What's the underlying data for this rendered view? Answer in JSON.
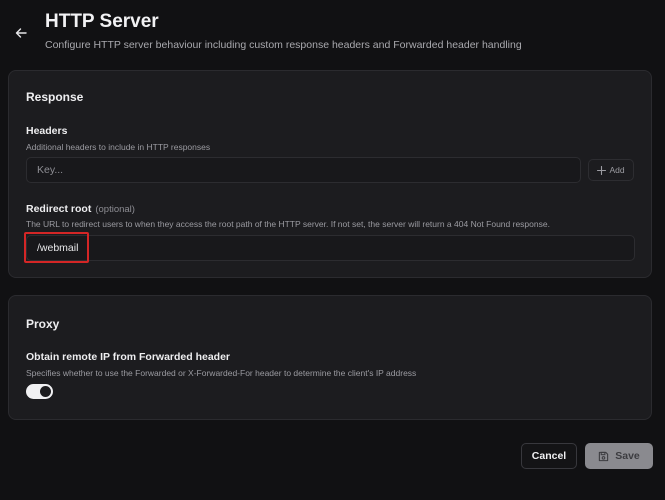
{
  "header": {
    "title": "HTTP Server",
    "subtitle": "Configure HTTP server behaviour including custom response headers and Forwarded header handling"
  },
  "response": {
    "title": "Response",
    "headers": {
      "label": "Headers",
      "description": "Additional headers to include in HTTP responses",
      "key_placeholder": "Key...",
      "add_label": "Add"
    },
    "redirect_root": {
      "label": "Redirect root",
      "optional": "(optional)",
      "description": "The URL to redirect users to when they access the root path of the HTTP server. If not set, the server will return a 404 Not Found response.",
      "value": "/webmail"
    }
  },
  "proxy": {
    "title": "Proxy",
    "forwarded": {
      "label": "Obtain remote IP from Forwarded header",
      "description": "Specifies whether to use the Forwarded or X-Forwarded-For header to determine the client's IP address",
      "enabled": true
    }
  },
  "footer": {
    "cancel_label": "Cancel",
    "save_label": "Save"
  },
  "icons": {
    "back": "arrow-left-icon",
    "add": "plus-icon",
    "save": "floppy-disk-icon"
  },
  "colors": {
    "highlight": "#d42626",
    "toggle_on": "#f1f1f3",
    "save_disabled": "#8a8a8f"
  }
}
